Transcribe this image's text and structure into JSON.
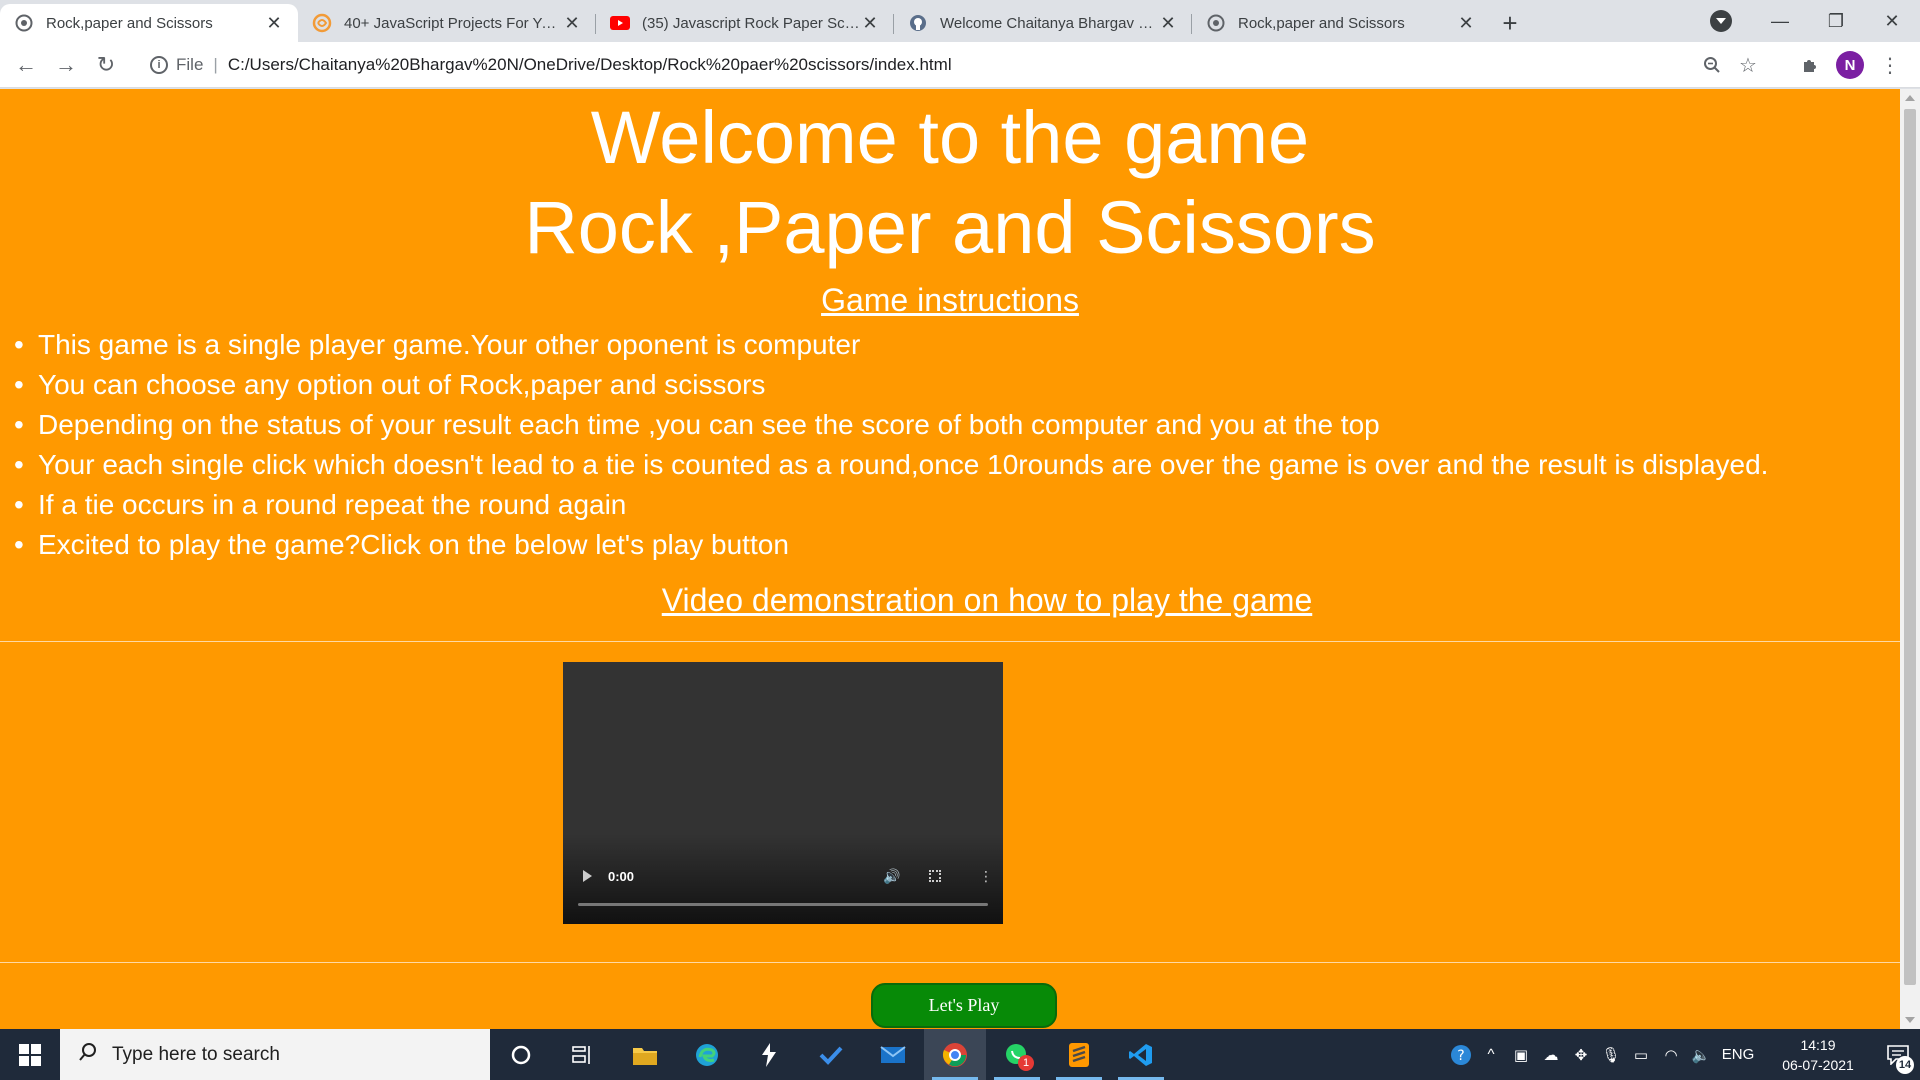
{
  "browser": {
    "tabs": [
      {
        "title": "Rock,paper and Scissors",
        "icon": "globe-icon",
        "active": true
      },
      {
        "title": "40+ JavaScript Projects For Your Portfolio",
        "icon": "swirl-icon",
        "active": false
      },
      {
        "title": "(35) Javascript Rock Paper Scissors",
        "icon": "youtube-icon",
        "active": false
      },
      {
        "title": "Welcome Chaitanya Bhargav N to",
        "icon": "github-icon",
        "active": false
      },
      {
        "title": "Rock,paper and Scissors",
        "icon": "globe-icon",
        "active": false
      }
    ],
    "new_tab_label": "+",
    "address": {
      "scheme_label": "File",
      "url": "C:/Users/Chaitanya%20Bhargav%20N/OneDrive/Desktop/Rock%20paer%20scissors/index.html"
    },
    "profile_initial": "N"
  },
  "page": {
    "welcome": "Welcome to the game",
    "game_name": "Rock ,Paper and Scissors",
    "instructions_heading": "Game instructions",
    "rules": [
      "This game is a single player game.Your other oponent is computer",
      "You can choose any option out of Rock,paper and scissors",
      "Depending on the status of your result each time ,you can see the score of both computer and you at the top",
      "Your each single click which doesn't lead to a tie is counted as a round,once 10rounds are over the game is over and the result is displayed.",
      "If a tie occurs in a round repeat the round again",
      "Excited to play the game?Click on the below let's play button"
    ],
    "video_link": "Video demonstration on how to play the game",
    "video": {
      "time": "0:00"
    },
    "play_button": "Let's Play"
  },
  "taskbar": {
    "search_placeholder": "Type here to search",
    "language": "ENG",
    "time": "14:19",
    "date": "06-07-2021",
    "notification_count": "14",
    "whatsapp_badge": "1"
  },
  "colors": {
    "page_background": "#ff9900",
    "play_button": "#078a07",
    "taskbar": "#1f2a3a"
  }
}
